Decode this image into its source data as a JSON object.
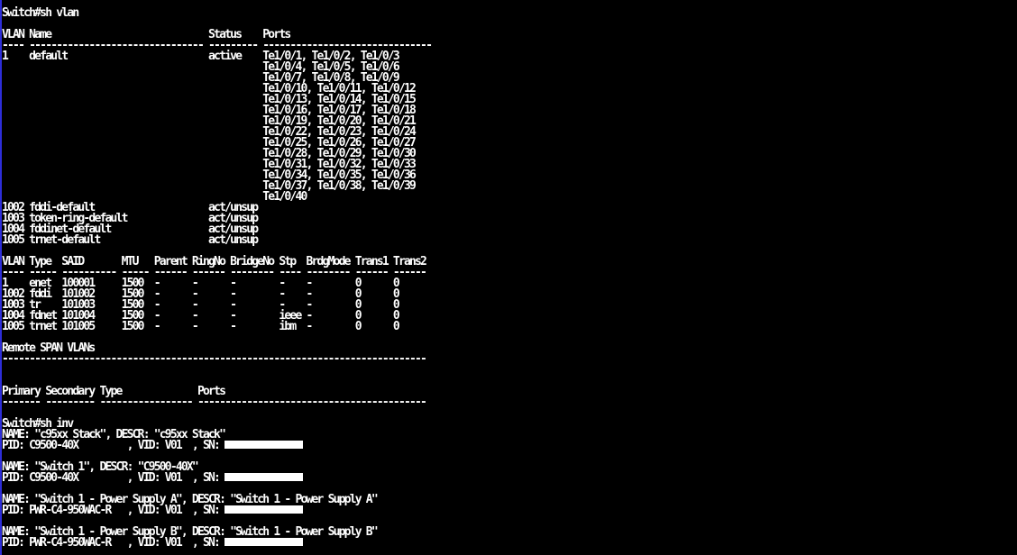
{
  "terminal": {
    "colors": {
      "background": "#000000",
      "foreground": "#ffffff",
      "edge": "#2d2dd8"
    },
    "lines": [
      "Switch#sh vlan",
      "",
      "VLAN Name                             Status    Ports",
      "---- -------------------------------- --------- -------------------------------",
      "1    default                          active    Te1/0/1, Te1/0/2, Te1/0/3",
      "                                                Te1/0/4, Te1/0/5, Te1/0/6",
      "                                                Te1/0/7, Te1/0/8, Te1/0/9",
      "                                                Te1/0/10, Te1/0/11, Te1/0/12",
      "                                                Te1/0/13, Te1/0/14, Te1/0/15",
      "                                                Te1/0/16, Te1/0/17, Te1/0/18",
      "                                                Te1/0/19, Te1/0/20, Te1/0/21",
      "                                                Te1/0/22, Te1/0/23, Te1/0/24",
      "                                                Te1/0/25, Te1/0/26, Te1/0/27",
      "                                                Te1/0/28, Te1/0/29, Te1/0/30",
      "                                                Te1/0/31, Te1/0/32, Te1/0/33",
      "                                                Te1/0/34, Te1/0/35, Te1/0/36",
      "                                                Te1/0/37, Te1/0/38, Te1/0/39",
      "                                                Te1/0/40",
      "1002 fddi-default                     act/unsup",
      "1003 token-ring-default               act/unsup",
      "1004 fddinet-default                  act/unsup",
      "1005 trnet-default                    act/unsup",
      "",
      "VLAN Type  SAID       MTU   Parent RingNo BridgeNo Stp  BrdgMode Trans1 Trans2",
      "---- ----- ---------- ----- ------ ------ -------- ---- -------- ------ ------",
      "1    enet  100001     1500  -      -      -        -    -        0      0",
      "1002 fddi  101002     1500  -      -      -        -    -        0      0",
      "1003 tr    101003     1500  -      -      -        -    -        0      0",
      "1004 fdnet 101004     1500  -      -      -        ieee -        0      0",
      "1005 trnet 101005     1500  -      -      -        ibm  -        0      0",
      "",
      "Remote SPAN VLANs",
      "------------------------------------------------------------------------------",
      "",
      "",
      "Primary Secondary Type              Ports",
      "------- --------- ----------------- ------------------------------------------",
      "",
      "Switch#sh inv",
      "NAME: \"c95xx Stack\", DESCR: \"c95xx Stack\"",
      "PID: C9500-40X         , VID: V01  , SN: [REDACTED]",
      "",
      "NAME: \"Switch 1\", DESCR: \"C9500-40X\"",
      "PID: C9500-40X         , VID: V01  , SN: [REDACTED]",
      "",
      "NAME: \"Switch 1 - Power Supply A\", DESCR: \"Switch 1 - Power Supply A\"",
      "PID: PWR-C4-950WAC-R   , VID: V01  , SN: [REDACTED]",
      "",
      "NAME: \"Switch 1 - Power Supply B\", DESCR: \"Switch 1 - Power Supply B\"",
      "PID: PWR-C4-950WAC-R   , VID: V01  , SN: [REDACTED]"
    ]
  }
}
